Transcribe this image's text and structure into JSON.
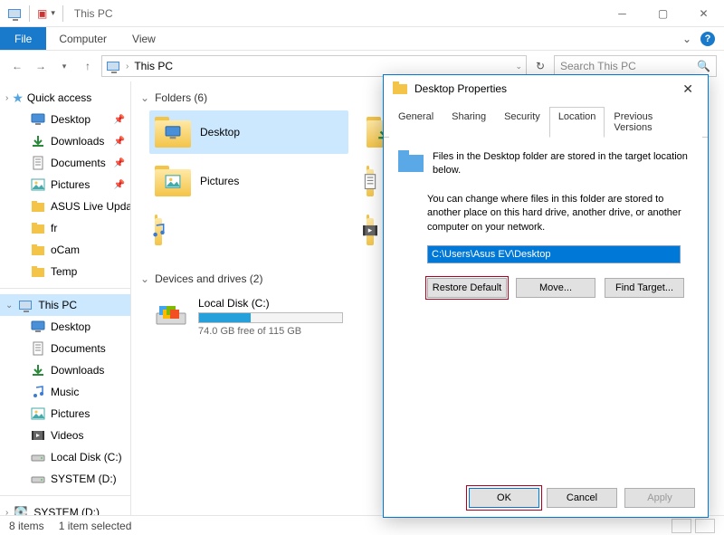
{
  "titlebar": {
    "title": "This PC"
  },
  "ribbon": {
    "file": "File",
    "tabs": [
      "Computer",
      "View"
    ]
  },
  "nav": {
    "location": "This PC",
    "search_placeholder": "Search This PC"
  },
  "sidebar": {
    "quick_access": "Quick access",
    "quick_items": [
      {
        "label": "Desktop",
        "pinned": true,
        "icon": "desktop"
      },
      {
        "label": "Downloads",
        "pinned": true,
        "icon": "downloads"
      },
      {
        "label": "Documents",
        "pinned": true,
        "icon": "documents"
      },
      {
        "label": "Pictures",
        "pinned": true,
        "icon": "pictures"
      },
      {
        "label": "ASUS Live Updat",
        "pinned": false,
        "icon": "folder"
      },
      {
        "label": "fr",
        "pinned": false,
        "icon": "folder"
      },
      {
        "label": "oCam",
        "pinned": false,
        "icon": "folder"
      },
      {
        "label": "Temp",
        "pinned": false,
        "icon": "folder"
      }
    ],
    "this_pc": "This PC",
    "pc_items": [
      {
        "label": "Desktop",
        "icon": "desktop"
      },
      {
        "label": "Documents",
        "icon": "documents"
      },
      {
        "label": "Downloads",
        "icon": "downloads"
      },
      {
        "label": "Music",
        "icon": "music"
      },
      {
        "label": "Pictures",
        "icon": "pictures"
      },
      {
        "label": "Videos",
        "icon": "videos"
      },
      {
        "label": "Local Disk (C:)",
        "icon": "drive"
      },
      {
        "label": "SYSTEM (D:)",
        "icon": "drive"
      }
    ],
    "bottom_drive": "SYSTEM (D:)"
  },
  "content": {
    "folders_header": "Folders (6)",
    "folders": [
      {
        "label": "Desktop",
        "selected": true,
        "icon": "desktop"
      },
      {
        "label": "Downloads",
        "selected": false,
        "icon": "downloads"
      },
      {
        "label": "Pictures",
        "selected": false,
        "icon": "pictures"
      }
    ],
    "drives_header": "Devices and drives (2)",
    "drive": {
      "name": "Local Disk (C:)",
      "free_text": "74.0 GB free of 115 GB",
      "fill_percent": 36
    }
  },
  "statusbar": {
    "count": "8 items",
    "selection": "1 item selected"
  },
  "dialog": {
    "title": "Desktop Properties",
    "tabs": [
      "General",
      "Sharing",
      "Security",
      "Location",
      "Previous Versions"
    ],
    "active_tab": "Location",
    "intro": "Files in the Desktop folder are stored in the target location below.",
    "desc": "You can change where files in this folder are stored to another place on this hard drive, another drive, or another computer on your network.",
    "path": "C:\\Users\\Asus EV\\Desktop",
    "buttons": {
      "restore": "Restore Default",
      "move": "Move...",
      "find": "Find Target..."
    },
    "footer": {
      "ok": "OK",
      "cancel": "Cancel",
      "apply": "Apply"
    }
  }
}
